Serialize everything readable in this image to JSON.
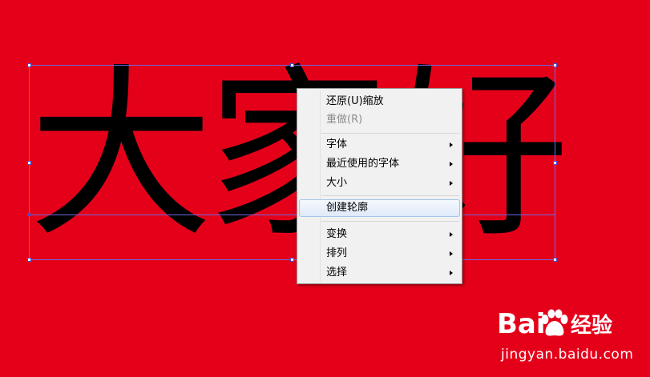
{
  "canvas": {
    "background": "#e5001a",
    "text": "大家好",
    "text_color": "#000000",
    "selection_color": "#6a6ae0"
  },
  "context_menu": {
    "items": [
      {
        "label": "还原(U)缩放",
        "enabled": true,
        "submenu": false
      },
      {
        "label": "重做(R)",
        "enabled": false,
        "submenu": false
      },
      {
        "label": "字体",
        "enabled": true,
        "submenu": true
      },
      {
        "label": "最近使用的字体",
        "enabled": true,
        "submenu": true
      },
      {
        "label": "大小",
        "enabled": true,
        "submenu": true
      },
      {
        "label": "创建轮廓",
        "enabled": true,
        "submenu": false,
        "highlighted": true
      },
      {
        "label": "变换",
        "enabled": true,
        "submenu": true
      },
      {
        "label": "排列",
        "enabled": true,
        "submenu": true
      },
      {
        "label": "选择",
        "enabled": true,
        "submenu": true
      }
    ]
  },
  "watermark": {
    "logo": "Bai",
    "logo_icon": "paw-icon",
    "brand": "经验",
    "url": "jingyan.baidu.com"
  }
}
